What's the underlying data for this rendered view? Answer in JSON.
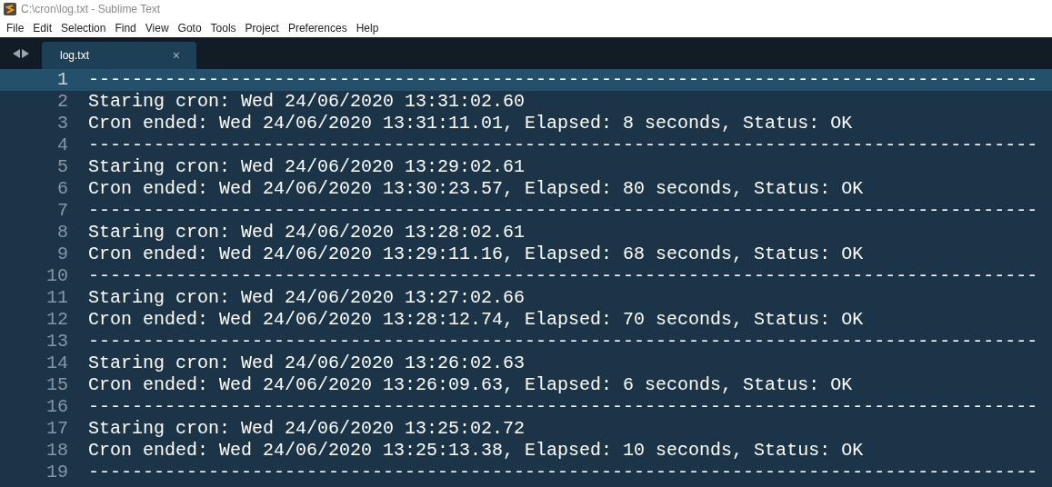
{
  "window": {
    "title": "C:\\cron\\log.txt - Sublime Text"
  },
  "menu": [
    "File",
    "Edit",
    "Selection",
    "Find",
    "View",
    "Goto",
    "Tools",
    "Project",
    "Preferences",
    "Help"
  ],
  "tabs": [
    {
      "label": "log.txt",
      "selected": true,
      "close": "×"
    }
  ],
  "editor": {
    "lines": [
      {
        "number": "1",
        "text": "---------------------------------------------------------------------------------------",
        "current": true
      },
      {
        "number": "2",
        "text": "Staring cron: Wed 24/06/2020 13:31:02.60",
        "current": false
      },
      {
        "number": "3",
        "text": "Cron ended: Wed 24/06/2020 13:31:11.01, Elapsed: 8 seconds, Status: OK",
        "current": false
      },
      {
        "number": "4",
        "text": "---------------------------------------------------------------------------------------",
        "current": false
      },
      {
        "number": "5",
        "text": "Staring cron: Wed 24/06/2020 13:29:02.61",
        "current": false
      },
      {
        "number": "6",
        "text": "Cron ended: Wed 24/06/2020 13:30:23.57, Elapsed: 80 seconds, Status: OK",
        "current": false
      },
      {
        "number": "7",
        "text": "---------------------------------------------------------------------------------------",
        "current": false
      },
      {
        "number": "8",
        "text": "Staring cron: Wed 24/06/2020 13:28:02.61",
        "current": false
      },
      {
        "number": "9",
        "text": "Cron ended: Wed 24/06/2020 13:29:11.16, Elapsed: 68 seconds, Status: OK",
        "current": false
      },
      {
        "number": "10",
        "text": "---------------------------------------------------------------------------------------",
        "current": false
      },
      {
        "number": "11",
        "text": "Staring cron: Wed 24/06/2020 13:27:02.66",
        "current": false
      },
      {
        "number": "12",
        "text": "Cron ended: Wed 24/06/2020 13:28:12.74, Elapsed: 70 seconds, Status: OK",
        "current": false
      },
      {
        "number": "13",
        "text": "---------------------------------------------------------------------------------------",
        "current": false
      },
      {
        "number": "14",
        "text": "Staring cron: Wed 24/06/2020 13:26:02.63",
        "current": false
      },
      {
        "number": "15",
        "text": "Cron ended: Wed 24/06/2020 13:26:09.63, Elapsed: 6 seconds, Status: OK",
        "current": false
      },
      {
        "number": "16",
        "text": "---------------------------------------------------------------------------------------",
        "current": false
      },
      {
        "number": "17",
        "text": "Staring cron: Wed 24/06/2020 13:25:02.72",
        "current": false
      },
      {
        "number": "18",
        "text": "Cron ended: Wed 24/06/2020 13:25:13.38, Elapsed: 10 seconds, Status: OK",
        "current": false
      },
      {
        "number": "19",
        "text": "---------------------------------------------------------------------------------------",
        "current": false
      }
    ]
  }
}
